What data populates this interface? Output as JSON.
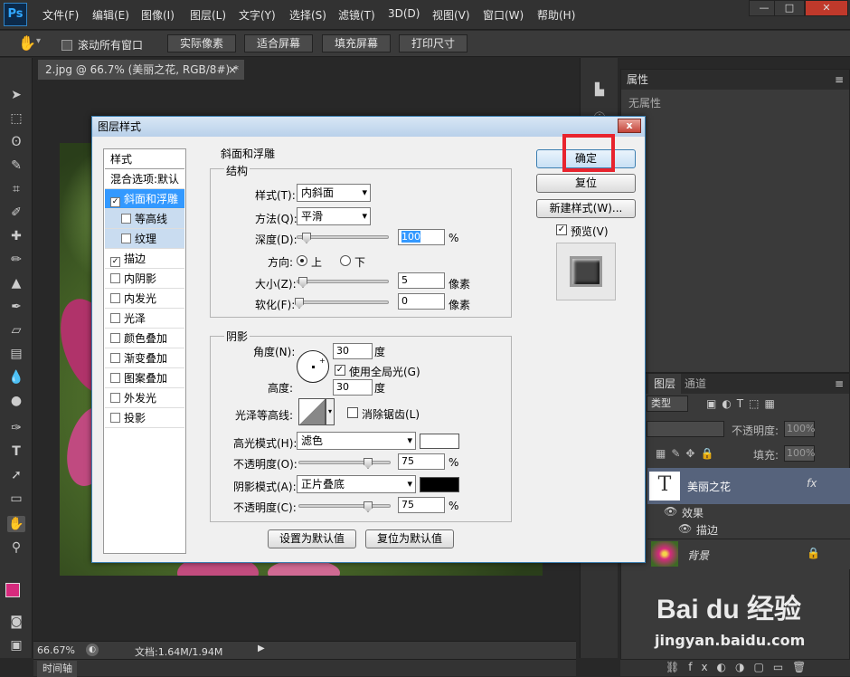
{
  "menubar": {
    "logo": "Ps",
    "items": [
      "文件(F)",
      "编辑(E)",
      "图像(I)",
      "图层(L)",
      "文字(Y)",
      "选择(S)",
      "滤镜(T)",
      "3D(D)",
      "视图(V)",
      "窗口(W)",
      "帮助(H)"
    ],
    "win_min": "—",
    "win_max": "□",
    "win_close": "✕"
  },
  "optbar": {
    "scroll_all": "滚动所有窗口",
    "buttons": [
      "实际像素",
      "适合屏幕",
      "填充屏幕",
      "打印尺寸"
    ]
  },
  "document": {
    "tab_title": "2.jpg @ 66.7% (美丽之花, RGB/8#) *",
    "zoom": "66.67%",
    "doc_size": "文档:1.64M/1.94M",
    "timeline": "时间轴"
  },
  "properties": {
    "tab": "属性",
    "empty": "无属性"
  },
  "layers": {
    "tabs": [
      "图层",
      "通道"
    ],
    "kind": "类型",
    "opacity_label": "不透明度:",
    "opacity_value": "100%",
    "fill_label": "填充:",
    "fill_value": "100%",
    "text_layer_name": "美丽之花",
    "fx": "fx",
    "effects_label": "效果",
    "stroke_effect": "描边",
    "bg_layer_name": "背景",
    "lock_label": "锁"
  },
  "dialog": {
    "title": "图层样式",
    "close": "x",
    "style_header": "样式",
    "styles": [
      {
        "label": "混合选项:默认",
        "checkbox": false,
        "checked": false,
        "selected": false,
        "sub": false
      },
      {
        "label": "斜面和浮雕",
        "checkbox": true,
        "checked": true,
        "selected": true,
        "sub": false
      },
      {
        "label": "等高线",
        "checkbox": true,
        "checked": false,
        "selected": false,
        "sub": true
      },
      {
        "label": "纹理",
        "checkbox": true,
        "checked": false,
        "selected": false,
        "sub": true
      },
      {
        "label": "描边",
        "checkbox": true,
        "checked": true,
        "selected": false,
        "sub": false
      },
      {
        "label": "内阴影",
        "checkbox": true,
        "checked": false,
        "selected": false,
        "sub": false
      },
      {
        "label": "内发光",
        "checkbox": true,
        "checked": false,
        "selected": false,
        "sub": false
      },
      {
        "label": "光泽",
        "checkbox": true,
        "checked": false,
        "selected": false,
        "sub": false
      },
      {
        "label": "颜色叠加",
        "checkbox": true,
        "checked": false,
        "selected": false,
        "sub": false
      },
      {
        "label": "渐变叠加",
        "checkbox": true,
        "checked": false,
        "selected": false,
        "sub": false
      },
      {
        "label": "图案叠加",
        "checkbox": true,
        "checked": false,
        "selected": false,
        "sub": false
      },
      {
        "label": "外发光",
        "checkbox": true,
        "checked": false,
        "selected": false,
        "sub": false
      },
      {
        "label": "投影",
        "checkbox": true,
        "checked": false,
        "selected": false,
        "sub": false
      }
    ],
    "bevel": {
      "section": "斜面和浮雕",
      "structure": "结构",
      "style_label": "样式(T):",
      "style_value": "内斜面",
      "technique_label": "方法(Q):",
      "technique_value": "平滑",
      "depth_label": "深度(D):",
      "depth_value": "100",
      "depth_unit": "%",
      "direction_label": "方向:",
      "dir_up": "上",
      "dir_down": "下",
      "size_label": "大小(Z):",
      "size_value": "5",
      "size_unit": "像素",
      "soften_label": "软化(F):",
      "soften_value": "0",
      "soften_unit": "像素"
    },
    "shading": {
      "section": "阴影",
      "angle_label": "角度(N):",
      "angle_value": "30",
      "angle_unit": "度",
      "global_light": "使用全局光(G)",
      "altitude_label": "高度:",
      "altitude_value": "30",
      "altitude_unit": "度",
      "gloss_label": "光泽等高线:",
      "anti_alias": "消除锯齿(L)",
      "highlight_mode_label": "高光模式(H):",
      "highlight_mode": "滤色",
      "highlight_color": "#ffffff",
      "hl_opacity_label": "不透明度(O):",
      "hl_opacity": "75",
      "shadow_mode_label": "阴影模式(A):",
      "shadow_mode": "正片叠底",
      "shadow_color": "#000000",
      "sh_opacity_label": "不透明度(C):",
      "sh_opacity": "75",
      "pct": "%"
    },
    "make_default": "设置为默认值",
    "reset_default": "复位为默认值",
    "ok": "确定",
    "reset": "复位",
    "new_style": "新建样式(W)...",
    "preview": "预览(V)"
  },
  "watermark": {
    "brand": "Bai du 经验",
    "url": "jingyan.baidu.com"
  }
}
